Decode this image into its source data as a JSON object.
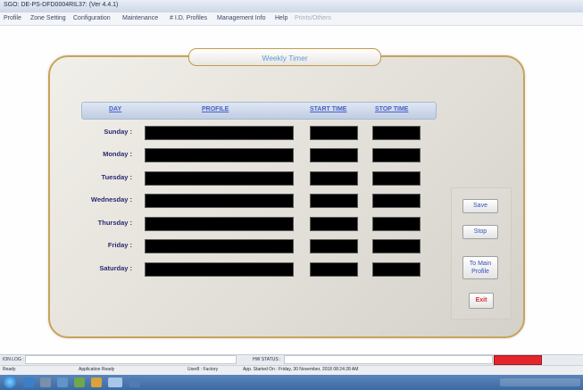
{
  "window": {
    "title": "SGO: DE-PS-DFD0004RIL37: (Ver 4.4.1)"
  },
  "menu": [
    {
      "label": "Profile",
      "dim": false
    },
    {
      "label": "Zone Setting",
      "dim": false
    },
    {
      "label": "Configuration",
      "dim": false
    },
    {
      "label": "Maintenance",
      "dim": false
    },
    {
      "label": "# I.D. Profiles",
      "dim": false
    },
    {
      "label": "Management Info",
      "dim": false
    },
    {
      "label": "Help",
      "dim": false
    },
    {
      "label": "Prints/Others",
      "dim": true
    }
  ],
  "panel": {
    "legend": "Weekly Timer"
  },
  "table": {
    "headers": {
      "day": "DAY",
      "profile": "PROFILE",
      "start": "START TIME",
      "stop": "STOP TIME"
    },
    "rows": [
      {
        "day": "Sunday :"
      },
      {
        "day": "Monday :"
      },
      {
        "day": "Tuesday :"
      },
      {
        "day": "Wednesday :"
      },
      {
        "day": "Thursday :"
      },
      {
        "day": "Friday :"
      },
      {
        "day": "Saturday :"
      }
    ]
  },
  "buttons": {
    "save": "Save",
    "stop": "Stop",
    "to_main_line1": "To Main",
    "to_main_line2": "Profile",
    "exit": "Exit"
  },
  "status": {
    "left_label": "ION LOG :",
    "center_label": "HW STATUS :",
    "state": "Ready",
    "app_status": "Application Ready",
    "user": "User8 : Factory",
    "app_started": "App. Started On : Friday, 30 November, 2018 08:24:28 AM"
  },
  "colors": {
    "panel_border": "#c8a35a",
    "header_text": "#4a60c8",
    "field": "#000000",
    "exit_text": "#d83030",
    "taskbar": "#3c6aa3"
  }
}
